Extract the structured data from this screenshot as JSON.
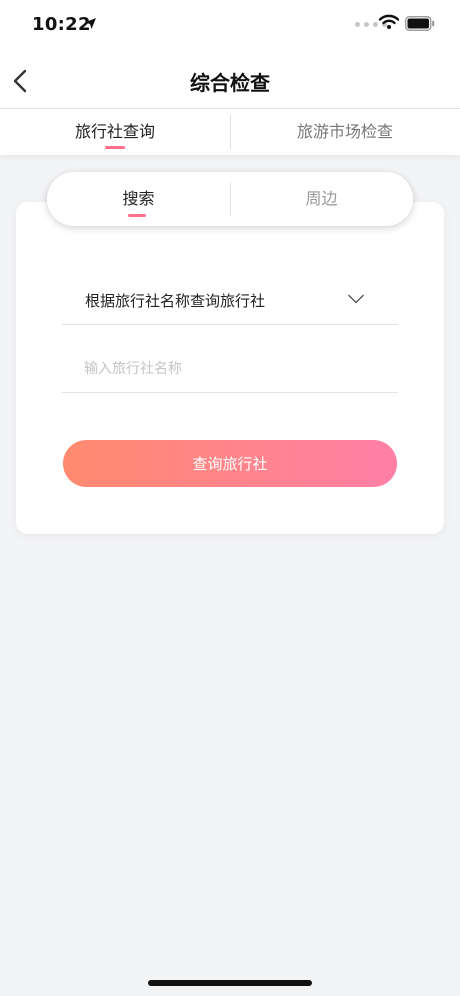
{
  "status_bar": {
    "time": "10:22"
  },
  "nav": {
    "title": "综合检查"
  },
  "top_tabs": [
    {
      "label": "旅行社查询",
      "active": true
    },
    {
      "label": "旅游市场检查",
      "active": false
    }
  ],
  "segment": [
    {
      "label": "搜索",
      "active": true
    },
    {
      "label": "周边",
      "active": false
    }
  ],
  "form": {
    "select_value": "根据旅行社名称查询旅行社",
    "name_placeholder": "输入旅行社名称",
    "query_button_label": "查询旅行社"
  },
  "colors": {
    "accent": "#ff6f8a",
    "button_gradient_start": "#ff8a6e",
    "button_gradient_end": "#ff7fa6",
    "background": "#f3f4f6"
  },
  "icons": [
    "location-arrow-icon",
    "signal-icon",
    "wifi-icon",
    "battery-icon",
    "back-arrow-icon",
    "chevron-down-icon"
  ]
}
